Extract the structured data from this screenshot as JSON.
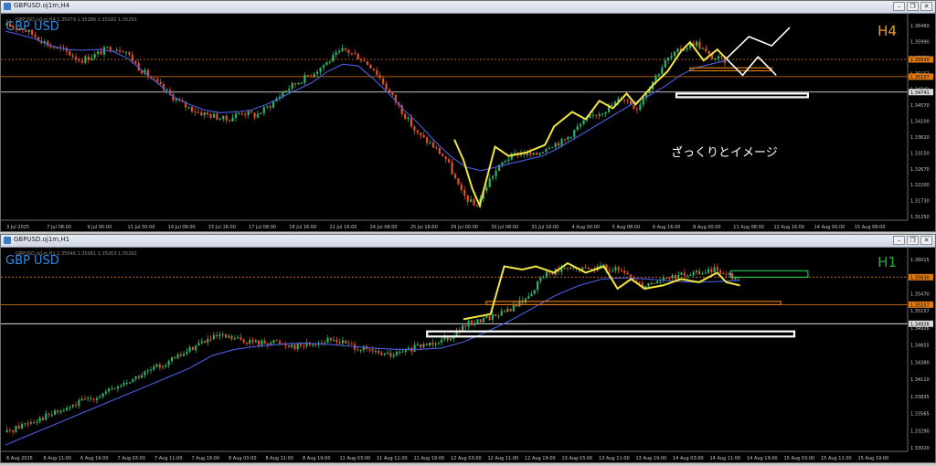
{
  "colors": {
    "background": "#000000",
    "bull": "#2fb36a",
    "bear": "#e0502a",
    "ma": "#4a5fe0",
    "zigzag": "#f2e640",
    "white": "#ffffff",
    "orange": "#e07a10",
    "green_box": "#25c050",
    "symbol_text": "#2f8ee8",
    "tf_top": "#e8a020",
    "tf_bottom": "#2fa83a"
  },
  "panels": [
    {
      "window_title": "GBPUSD.oj1m,H4",
      "ohlc_line": "GBPUSD.oj1m,H4  1.35079  1.35286  1.35182  1.35263",
      "symbol": "GBP USD",
      "timeframe": "H4",
      "annotation": "ざっくりとイメージ",
      "price_labels": [
        "1.36460",
        "1.35990",
        "1.35630",
        "1.35157",
        "1.34741",
        "1.34570",
        "1.34100",
        "1.33620",
        "1.33150",
        "1.32670",
        "1.32200",
        "1.31730",
        "1.31250"
      ],
      "price_highlights": [
        "1.35630",
        "1.35157",
        "1.34741"
      ],
      "time_labels": [
        "3 Jul 2025",
        "7 Jul 08:00",
        "9 Jul 00:00",
        "11 Jul 00:00",
        "14 Jul 08:00",
        "15 Jul 16:00",
        "17 Jul 08:00",
        "18 Jul 16:00",
        "21 Jul 16:00",
        "24 Jul 08:00",
        "25 Jul 16:00",
        "29 Jul 00:00",
        "30 Jul 08:00",
        "31 Jul 16:00",
        "4 Aug 00:00",
        "5 Aug 08:00",
        "6 Aug 16:00",
        "8 Aug 00:00",
        "11 Aug 08:00",
        "12 Aug 16:00",
        "14 Aug 00:00",
        "15 Aug 08:00"
      ]
    },
    {
      "window_title": "GBPUSD.oj1m,H1",
      "ohlc_line": "GBPUSD.oj1m,H1  1.35046  1.35081  1.35263  1.35263",
      "symbol": "GBP USD",
      "timeframe": "H1",
      "price_labels": [
        "1.36015",
        "1.35740",
        "1.35470",
        "1.35157",
        "1.34926",
        "1.34655",
        "1.34380",
        "1.34110",
        "1.33835",
        "1.33565",
        "1.33290",
        "1.33020"
      ],
      "price_highlights": [
        "1.35630",
        "1.35157",
        "1.34926"
      ],
      "time_labels": [
        "6 Aug 2025",
        "6 Aug 11:00",
        "6 Aug 19:00",
        "7 Aug 03:00",
        "7 Aug 11:00",
        "7 Aug 19:00",
        "8 Aug 03:00",
        "8 Aug 11:00",
        "8 Aug 19:00",
        "11 Aug 03:00",
        "11 Aug 11:00",
        "11 Aug 19:00",
        "12 Aug 03:00",
        "12 Aug 11:00",
        "12 Aug 19:00",
        "13 Aug 03:00",
        "13 Aug 11:00",
        "13 Aug 19:00",
        "14 Aug 03:00",
        "14 Aug 11:00",
        "14 Aug 19:00",
        "15 Aug 03:00",
        "15 Aug 11:00",
        "15 Aug 19:00"
      ]
    }
  ],
  "chart_data": [
    {
      "type": "candlestick",
      "title": "GBPUSD.oj1m,H4",
      "ylim": [
        1.3125,
        1.368
      ],
      "price_path": [
        1.3655,
        1.3648,
        1.3625,
        1.3598,
        1.3585,
        1.356,
        1.3575,
        1.3595,
        1.359,
        1.354,
        1.3505,
        1.347,
        1.344,
        1.342,
        1.341,
        1.3398,
        1.342,
        1.341,
        1.344,
        1.348,
        1.3505,
        1.353,
        1.356,
        1.359,
        1.357,
        1.354,
        1.348,
        1.342,
        1.336,
        1.333,
        1.329,
        1.32,
        1.316,
        1.324,
        1.329,
        1.331,
        1.33,
        1.333,
        1.334,
        1.338,
        1.341,
        1.343,
        1.346,
        1.343,
        1.35,
        1.356,
        1.359,
        1.361,
        1.357,
        1.356
      ],
      "ma_path": [
        1.364,
        1.363,
        1.3618,
        1.36,
        1.359,
        1.3588,
        1.359,
        1.3585,
        1.3565,
        1.353,
        1.3495,
        1.346,
        1.344,
        1.3425,
        1.3418,
        1.342,
        1.3425,
        1.344,
        1.346,
        1.348,
        1.35,
        1.353,
        1.355,
        1.3545,
        1.351,
        1.347,
        1.3425,
        1.3385,
        1.334,
        1.33,
        1.327,
        1.326,
        1.327,
        1.328,
        1.329,
        1.33,
        1.332,
        1.3345,
        1.337,
        1.3395,
        1.342,
        1.3445,
        1.3465,
        1.349,
        1.352,
        1.354,
        1.355,
        1.356
      ],
      "zigzag": [
        [
          0.5,
          1.3345
        ],
        [
          0.51,
          1.329
        ],
        [
          0.52,
          1.321
        ],
        [
          0.528,
          1.3165
        ],
        [
          0.545,
          1.3325
        ],
        [
          0.56,
          1.33
        ],
        [
          0.58,
          1.331
        ],
        [
          0.6,
          1.333
        ],
        [
          0.61,
          1.338
        ],
        [
          0.63,
          1.342
        ],
        [
          0.645,
          1.34
        ],
        [
          0.66,
          1.345
        ],
        [
          0.675,
          1.343
        ],
        [
          0.69,
          1.347
        ],
        [
          0.7,
          1.344
        ],
        [
          0.72,
          1.3495
        ],
        [
          0.735,
          1.353
        ],
        [
          0.75,
          1.3585
        ],
        [
          0.76,
          1.361
        ],
        [
          0.775,
          1.356
        ],
        [
          0.79,
          1.359
        ],
        [
          0.8,
          1.3565
        ]
      ],
      "projection": [
        [
          0.8,
          1.3565
        ],
        [
          0.818,
          1.352
        ],
        [
          0.835,
          1.357
        ],
        [
          0.855,
          1.352
        ]
      ],
      "projection_alt": [
        [
          0.8,
          1.3565
        ],
        [
          0.825,
          1.3625
        ],
        [
          0.85,
          1.36
        ],
        [
          0.87,
          1.365
        ]
      ],
      "horizontal_lines": [
        1.3563,
        1.3516,
        1.3474
      ],
      "zones": [
        {
          "color": "#ffffff",
          "y_top": 1.347,
          "y_bottom": 1.346,
          "x_from": 0.745,
          "x_to": 0.89
        },
        {
          "color": "#e07a10",
          "y_top": 1.354,
          "y_bottom": 1.3532,
          "x_from": 0.76,
          "x_to": 0.85
        }
      ]
    },
    {
      "type": "candlestick",
      "title": "GBPUSD.oj1m,H1",
      "ylim": [
        1.329,
        1.3605
      ],
      "price_path": [
        1.332,
        1.3335,
        1.3345,
        1.3355,
        1.337,
        1.338,
        1.3395,
        1.341,
        1.3425,
        1.344,
        1.346,
        1.347,
        1.3465,
        1.346,
        1.3462,
        1.3455,
        1.346,
        1.3465,
        1.3455,
        1.3445,
        1.344,
        1.345,
        1.346,
        1.347,
        1.349,
        1.35,
        1.351,
        1.353,
        1.357,
        1.3575,
        1.3575,
        1.358,
        1.357,
        1.355,
        1.356,
        1.3565,
        1.357,
        1.3575,
        1.356
      ],
      "ma_path": [
        1.33,
        1.3315,
        1.333,
        1.3345,
        1.336,
        1.3375,
        1.339,
        1.3405,
        1.342,
        1.344,
        1.345,
        1.3455,
        1.3458,
        1.346,
        1.3458,
        1.3455,
        1.3452,
        1.345,
        1.345,
        1.3452,
        1.3462,
        1.3478,
        1.3495,
        1.3515,
        1.3535,
        1.355,
        1.356,
        1.3562,
        1.356,
        1.3557,
        1.3555,
        1.3556,
        1.3558
      ],
      "zigzag": [
        [
          0.51,
          1.3497
        ],
        [
          0.54,
          1.3505
        ],
        [
          0.555,
          1.358
        ],
        [
          0.575,
          1.3575
        ],
        [
          0.59,
          1.358
        ],
        [
          0.61,
          1.357
        ],
        [
          0.625,
          1.3585
        ],
        [
          0.645,
          1.357
        ],
        [
          0.665,
          1.358
        ],
        [
          0.68,
          1.3545
        ],
        [
          0.695,
          1.356
        ],
        [
          0.71,
          1.3545
        ],
        [
          0.73,
          1.355
        ],
        [
          0.75,
          1.356
        ],
        [
          0.77,
          1.3555
        ],
        [
          0.79,
          1.357
        ],
        [
          0.8,
          1.3555
        ],
        [
          0.815,
          1.355
        ]
      ],
      "horizontal_lines": [
        1.3563,
        1.352,
        1.349
      ],
      "zones": [
        {
          "color": "#ffffff",
          "y_top": 1.3478,
          "y_bottom": 1.347,
          "x_from": 0.47,
          "x_to": 0.875
        },
        {
          "color": "#e07a10",
          "y_top": 1.3525,
          "y_bottom": 1.352,
          "x_from": 0.535,
          "x_to": 0.86
        },
        {
          "color": "#25c050",
          "y_top": 1.3573,
          "y_bottom": 1.3563,
          "x_from": 0.805,
          "x_to": 0.89
        }
      ]
    }
  ]
}
